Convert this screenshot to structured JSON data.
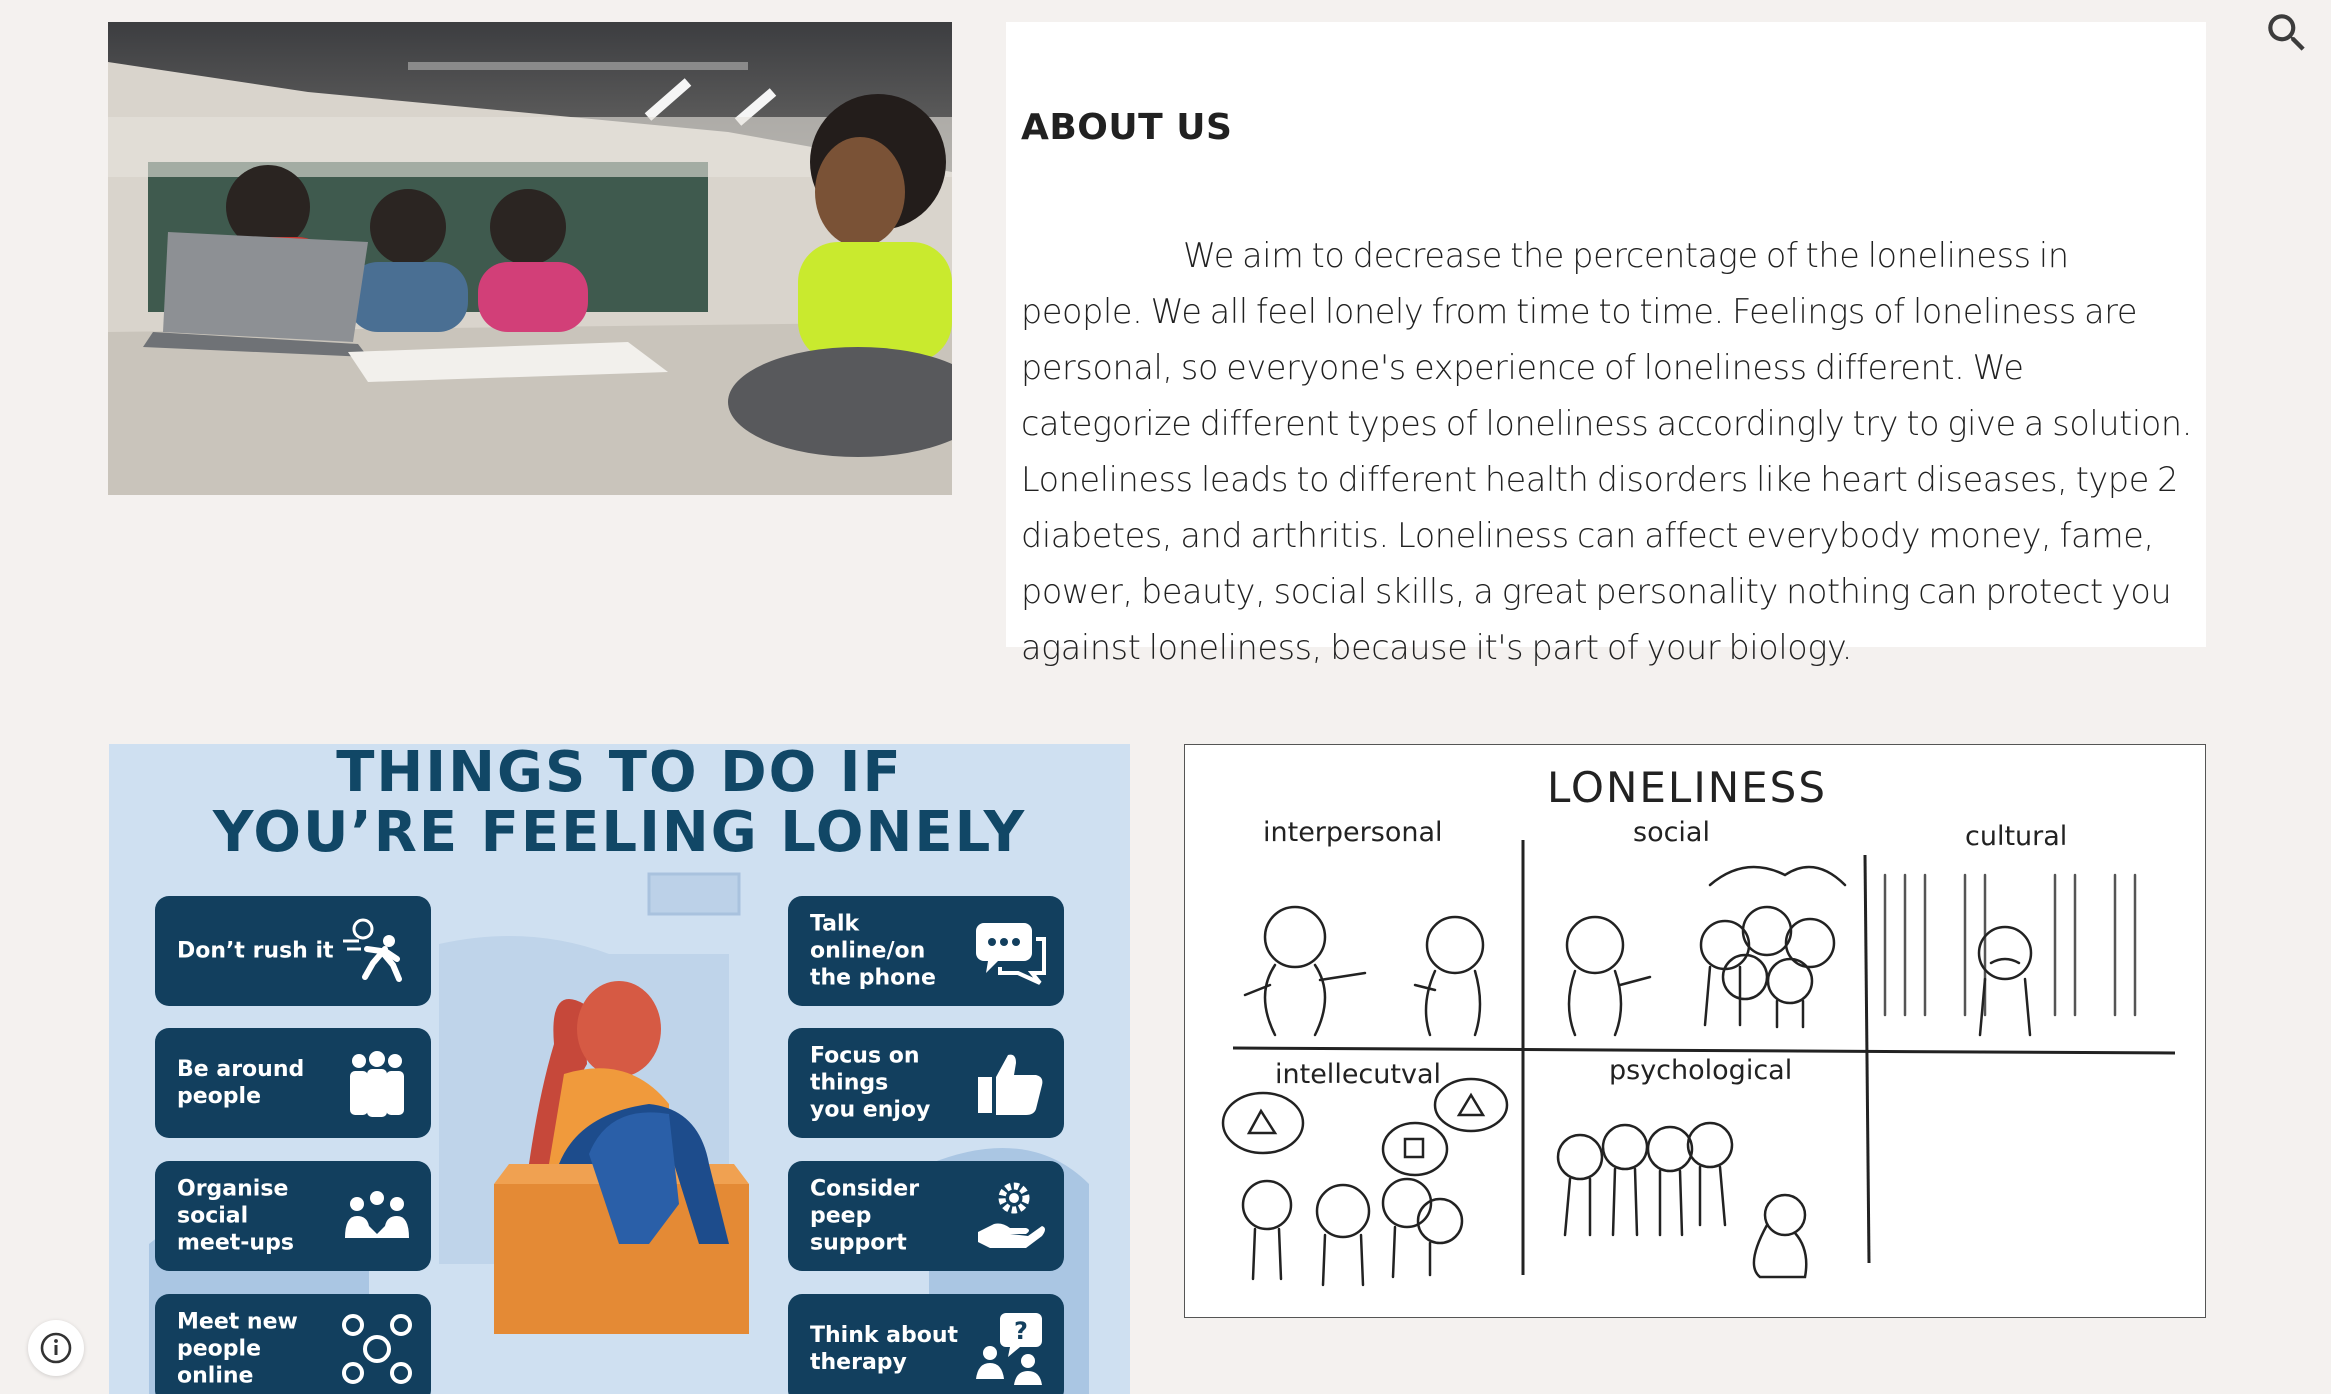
{
  "about": {
    "title": "ABOUT US",
    "body": "We aim to decrease the percentage of the loneliness in people. We all feel lonely from time to time. Feelings of loneliness are personal, so everyone's experience of loneliness different. We categorize different types of loneliness accordingly try to give a solution. Loneliness leads to different health disorders like heart diseases, type 2 diabetes, and arthritis. Loneliness can affect everybody money, fame, power, beauty, social skills, a great personality nothing can protect you against loneliness, because it's part of your biology."
  },
  "infographic": {
    "title_line1": "THINGS TO DO IF",
    "title_line2": "YOU’RE FEELING LONELY",
    "left_tips": [
      {
        "label": "Don’t rush it",
        "icon": "running-person-icon"
      },
      {
        "label": "Be around\npeople",
        "icon": "group-people-icon"
      },
      {
        "label": "Organise\nsocial\nmeet-ups",
        "icon": "meetup-icon"
      },
      {
        "label": "Meet new\npeople\nonline",
        "icon": "network-people-icon"
      }
    ],
    "right_tips": [
      {
        "label": "Talk\nonline/on\nthe phone",
        "icon": "chat-bubbles-icon"
      },
      {
        "label": "Focus on\nthings\nyou enjoy",
        "icon": "thumbs-up-icon"
      },
      {
        "label": "Consider\npeep\nsupport",
        "icon": "gear-hand-icon"
      },
      {
        "label": "Think about\ntherapy",
        "icon": "therapy-icon"
      }
    ]
  },
  "sketch": {
    "title": "LONELINESS",
    "cells": [
      "interpersonal",
      "social",
      "cultural",
      "intellecutval",
      "psychological"
    ]
  },
  "colors": {
    "page_bg": "#f4f1ef",
    "infographic_bg": "#cfe0f1",
    "tip_bg": "#123f5e",
    "title_blue": "#114766"
  }
}
